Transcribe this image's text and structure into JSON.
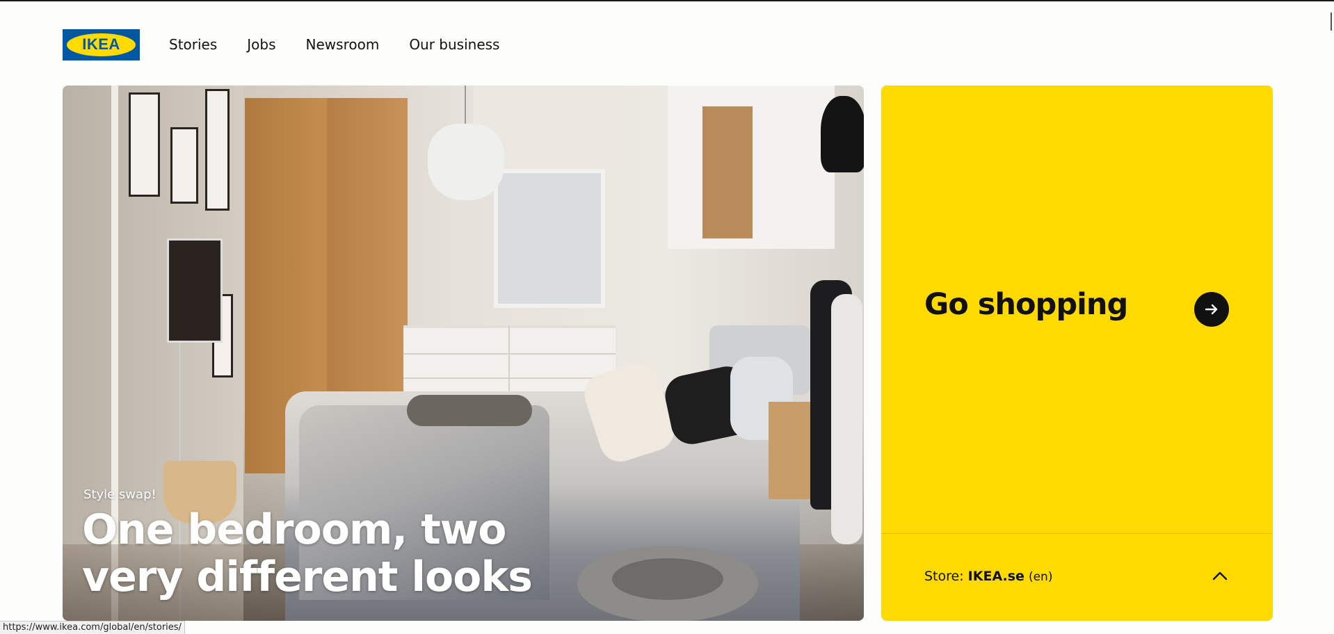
{
  "brand": {
    "logo_text": "IKEA",
    "blue": "#0058a3",
    "yellow": "#ffdb00"
  },
  "nav": {
    "items": [
      {
        "label": "Stories"
      },
      {
        "label": "Jobs"
      },
      {
        "label": "Newsroom"
      },
      {
        "label": "Our business"
      }
    ]
  },
  "hero": {
    "kicker": "Style swap!",
    "title": "One bedroom, two very different looks",
    "image_subject": "bedroom-photo"
  },
  "shop_card": {
    "title": "Go shopping",
    "arrow_icon": "arrow-right-icon",
    "store_label": "Store:",
    "store_name": "IKEA.se",
    "store_lang": "(en)",
    "chevron_icon": "chevron-up-icon",
    "background": "#ffda00"
  },
  "status_bar": {
    "url": "https://www.ikea.com/global/en/stories/"
  }
}
